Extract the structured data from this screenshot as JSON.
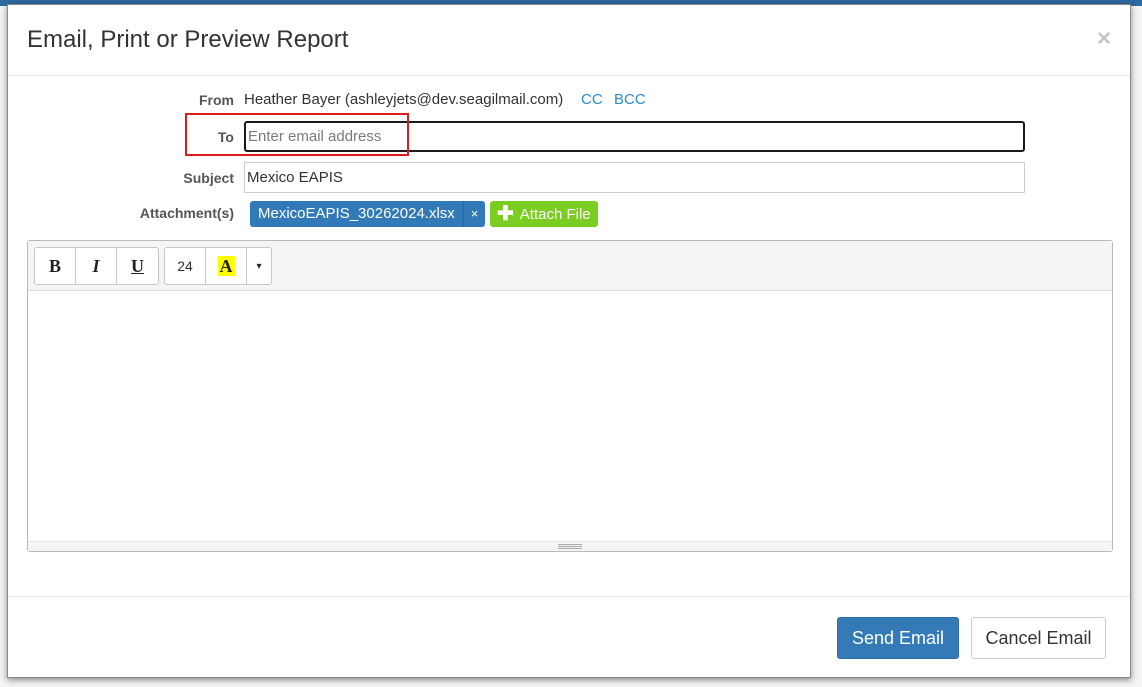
{
  "dialog": {
    "title": "Email, Print or Preview Report",
    "close_icon": "close-icon",
    "close_glyph": "×"
  },
  "form": {
    "from_label": "From",
    "from_value": "Heather Bayer (ashleyjets@dev.seagilmail.com)",
    "cc_label": "CC",
    "bcc_label": "BCC",
    "to_label": "To",
    "to_value": "",
    "to_placeholder": "Enter email address",
    "subject_label": "Subject",
    "subject_value": "Mexico EAPIS",
    "attachments_label": "Attachment(s)",
    "attachments": [
      {
        "name": "MexicoEAPIS_30262024.xlsx",
        "remove_glyph": "×"
      }
    ],
    "attach_button_icon": "plus-icon",
    "attach_button_glyph": "✚",
    "attach_button_label": "Attach File"
  },
  "editor": {
    "toolbar": {
      "bold_label": "B",
      "italic_label": "I",
      "underline_label": "U",
      "font_size": "24",
      "text_color_label": "A",
      "dropdown_glyph": "▾"
    },
    "body_text": ""
  },
  "footer": {
    "send_label": "Send Email",
    "cancel_label": "Cancel Email"
  },
  "colors": {
    "primary": "#337ab7",
    "success": "#7bcd22",
    "link": "#2a8ad4",
    "highlight_annotation": "#e01b1b",
    "text_color_highlight": "#ffff00"
  }
}
